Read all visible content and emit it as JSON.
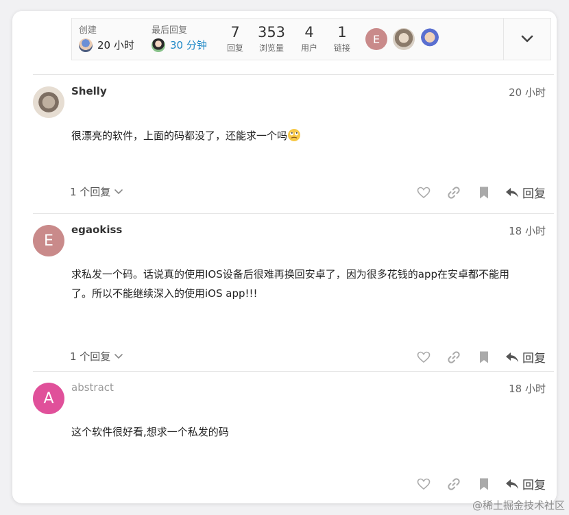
{
  "summary": {
    "created_label": "创建",
    "created_value": "20 小时",
    "last_reply_label": "最后回复",
    "last_reply_value": "30 分钟",
    "stats": [
      {
        "num": "7",
        "label": "回复"
      },
      {
        "num": "353",
        "label": "浏览量"
      },
      {
        "num": "4",
        "label": "用户"
      },
      {
        "num": "1",
        "label": "链接"
      }
    ],
    "participant_letter": "E"
  },
  "posts": [
    {
      "username": "Shelly",
      "time": "20 小时",
      "body": "很漂亮的软件，上面的码都没了，还能求一个吗",
      "replies": "1 个回复",
      "reply_label": "回复"
    },
    {
      "username": "egaokiss",
      "avatar_letter": "E",
      "time": "18 小时",
      "body_line1": "求私发一个码。话说真的使用IOS设备后很难再换回安卓了，因为很多花钱的app在安卓都不能用",
      "body_line2": "了。所以不能继续深入的使用iOS app!!!",
      "replies": "1 个回复",
      "reply_label": "回复"
    },
    {
      "username": "abstract",
      "avatar_letter": "A",
      "time": "18 小时",
      "body": "这个软件很好看,想求一个私发的码",
      "reply_label": "回复"
    }
  ],
  "watermark": "@稀土掘金技术社区",
  "colors": {
    "avatar_e": "#c98a8a",
    "avatar_a": "#e0509a",
    "link": "#1e88c7"
  }
}
